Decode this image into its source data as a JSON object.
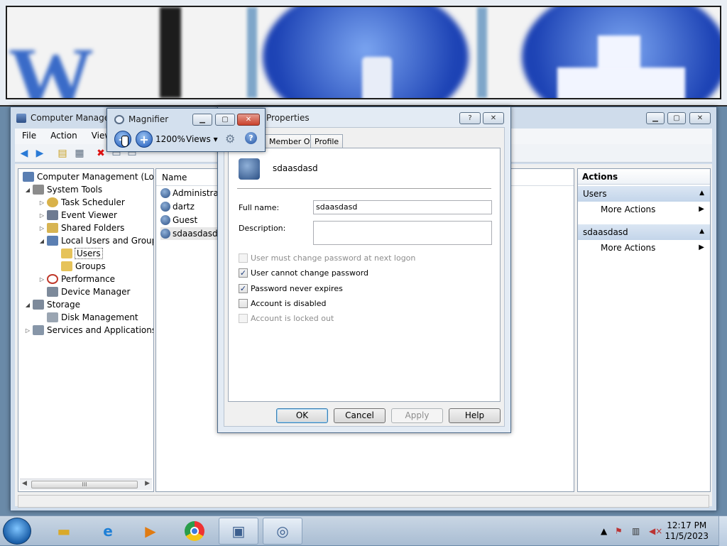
{
  "magnifier_lens": {
    "description_hidden": ""
  },
  "computer_management": {
    "title": "Computer Management",
    "menu": [
      "File",
      "Action",
      "View"
    ],
    "tree": [
      {
        "label": "Computer Management (Local",
        "level": 0,
        "expander": ""
      },
      {
        "label": "System Tools",
        "level": 1,
        "expander": "open"
      },
      {
        "label": "Task Scheduler",
        "level": 2,
        "expander": "closed"
      },
      {
        "label": "Event Viewer",
        "level": 2,
        "expander": "closed"
      },
      {
        "label": "Shared Folders",
        "level": 2,
        "expander": "closed"
      },
      {
        "label": "Local Users and Groups",
        "level": 2,
        "expander": "open"
      },
      {
        "label": "Users",
        "level": 3,
        "expander": "",
        "selected": true
      },
      {
        "label": "Groups",
        "level": 3,
        "expander": ""
      },
      {
        "label": "Performance",
        "level": 2,
        "expander": "closed"
      },
      {
        "label": "Device Manager",
        "level": 2,
        "expander": ""
      },
      {
        "label": "Storage",
        "level": 1,
        "expander": "open"
      },
      {
        "label": "Disk Management",
        "level": 2,
        "expander": ""
      },
      {
        "label": "Services and Applications",
        "level": 1,
        "expander": "closed"
      }
    ],
    "list_header": "Name",
    "users": [
      "Administrato",
      "dartz",
      "Guest",
      "sdaasdasd"
    ],
    "actions": {
      "header": "Actions",
      "sections": [
        {
          "title": "Users",
          "item": "More Actions"
        },
        {
          "title": "sdaasdasd",
          "item": "More Actions"
        }
      ]
    }
  },
  "magnifier": {
    "title": "Magnifier",
    "zoom": "1200%",
    "views_label": "Views",
    "zoom_out": "−",
    "zoom_in": "+"
  },
  "properties": {
    "title": "Properties",
    "tabs": [
      "Member Of",
      "Profile"
    ],
    "username": "sdaasdasd",
    "full_name_label": "Full name:",
    "full_name": "sdaasdasd",
    "description_label": "Description:",
    "description": "",
    "checkboxes": [
      {
        "label": "User must change password at next logon",
        "checked": false,
        "disabled": true
      },
      {
        "label": "User cannot change password",
        "checked": true,
        "disabled": false
      },
      {
        "label": "Password never expires",
        "checked": true,
        "disabled": false
      },
      {
        "label": "Account is disabled",
        "checked": false,
        "disabled": false
      },
      {
        "label": "Account is locked out",
        "checked": false,
        "disabled": true
      }
    ],
    "buttons": {
      "ok": "OK",
      "cancel": "Cancel",
      "apply": "Apply",
      "help": "Help"
    },
    "help_glyph": "?",
    "close_glyph": "✕"
  },
  "taskbar": {
    "time": "12:17 PM",
    "date": "11/5/2023",
    "apps": [
      "explorer",
      "internet-explorer",
      "media-player",
      "chrome",
      "computer-management",
      "magnifier"
    ]
  },
  "colors": {
    "accent": "#1b56b8",
    "selection": "#c3d5ea"
  }
}
